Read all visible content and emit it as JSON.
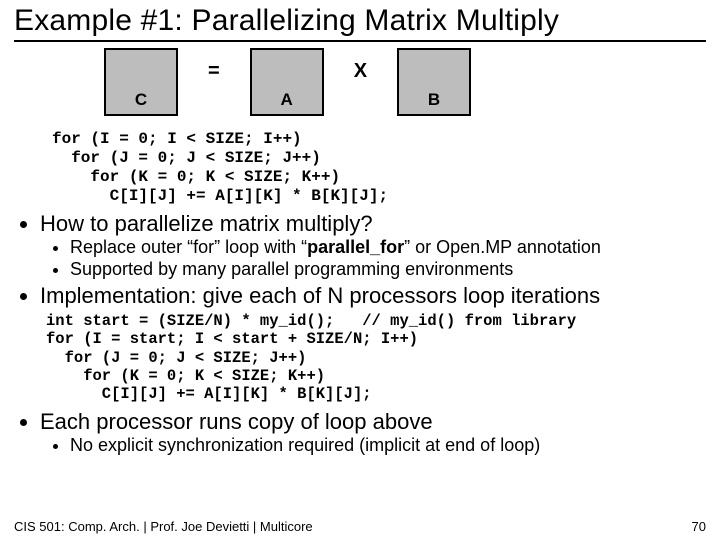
{
  "title": "Example #1: Parallelizing Matrix Multiply",
  "diagram": {
    "c": "C",
    "eq": "=",
    "a": "A",
    "x": "X",
    "b": "B"
  },
  "code1": "for (I = 0; I < SIZE; I++)\n  for (J = 0; J < SIZE; J++)\n    for (K = 0; K < SIZE; K++)\n      C[I][J] += A[I][K] * B[K][J];",
  "b1": "How to parallelize matrix multiply?",
  "b1s1_a": "Replace outer “for” loop with “",
  "b1s1_pf": "parallel_for",
  "b1s1_b": "” or Open.MP annotation",
  "b1s2": "Supported by many parallel programming environments",
  "b2": "Implementation: give each of N processors loop iterations",
  "code2": "int start = (SIZE/N) * my_id();   // my_id() from library\nfor (I = start; I < start + SIZE/N; I++)\n  for (J = 0; J < SIZE; J++)\n    for (K = 0; K < SIZE; K++)\n      C[I][J] += A[I][K] * B[K][J];",
  "b3": "Each processor runs copy of loop above",
  "b3s1": "No explicit synchronization required (implicit at end of loop)",
  "footer_left": "CIS 501: Comp. Arch.  |  Prof. Joe Devietti  |  Multicore",
  "footer_right": "70"
}
